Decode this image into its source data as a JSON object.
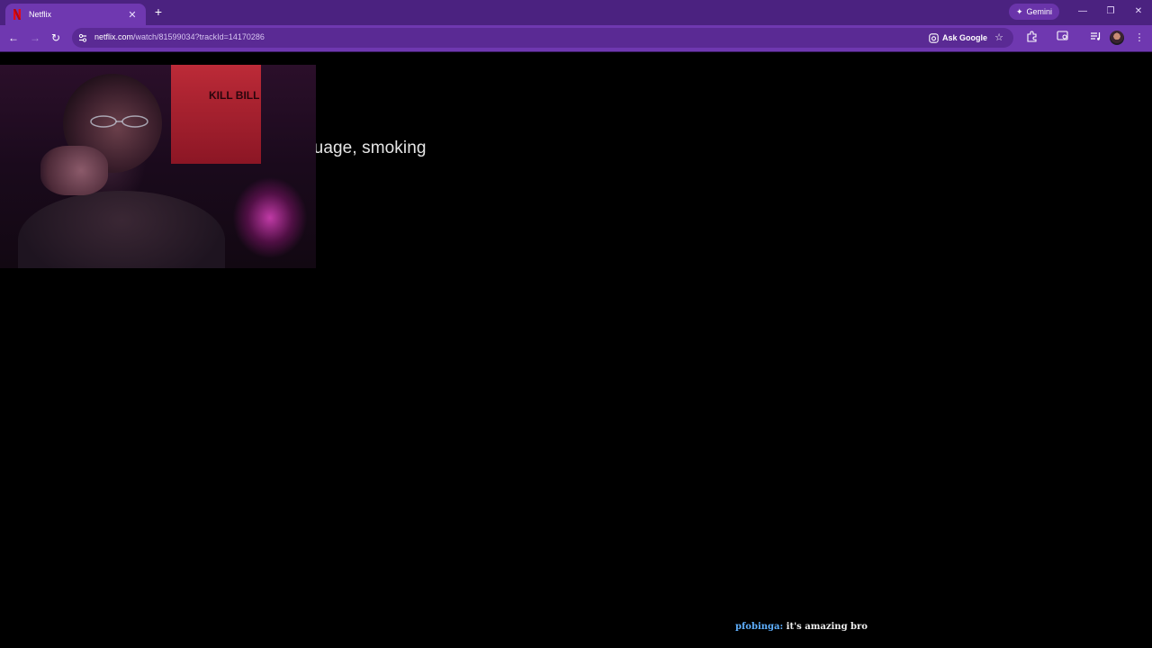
{
  "browser": {
    "tab": {
      "title": "Netflix",
      "favicon": "netflix-icon"
    },
    "new_tab_label": "+",
    "gemini_label": "Gemini",
    "window_controls": {
      "minimize": "—",
      "restore": "❐",
      "close": "✕"
    },
    "url": {
      "host": "netflix.com",
      "path": "/watch/81599034?trackId=14170286"
    },
    "ask_google_label": "Ask Google",
    "colors": {
      "tabbar": "#4b2280",
      "toolbar": "#6f38b0",
      "omnibox": "#5a2a94"
    }
  },
  "player": {
    "rating_text": "guage, smoking",
    "webcam": {
      "poster_text": "KILL BILL"
    }
  },
  "chat": {
    "username": "pfobinga:",
    "message": " it's amazing bro",
    "username_color": "#5fb0ff"
  }
}
